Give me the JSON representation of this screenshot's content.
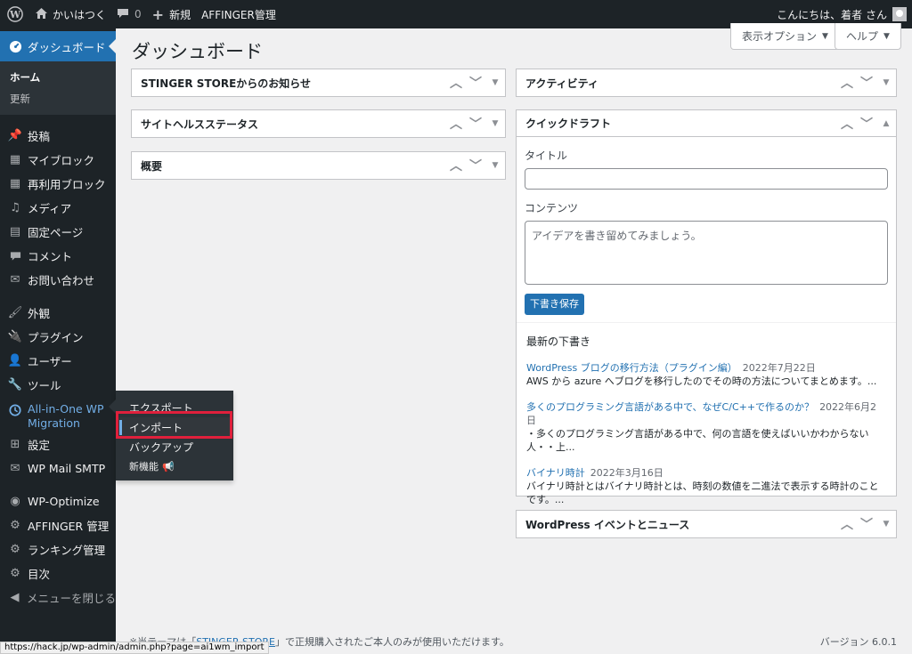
{
  "adminbar": {
    "site_name": "かいはつく",
    "comments_count": "0",
    "new_label": "新規",
    "affinger_label": "AFFINGER管理",
    "greeting": "こんにちは、着者 さん"
  },
  "sidebar": {
    "dashboard": "ダッシュボード",
    "home": "ホーム",
    "updates": "更新",
    "posts": "投稿",
    "my_blocks": "マイブロック",
    "reusable_blocks": "再利用ブロック",
    "media": "メディア",
    "pages": "固定ページ",
    "comments": "コメント",
    "contact": "お問い合わせ",
    "appearance": "外観",
    "plugins": "プラグイン",
    "users": "ユーザー",
    "tools": "ツール",
    "aio_line1": "All-in-One WP",
    "aio_line2": "Migration",
    "settings": "設定",
    "wp_mail": "WP Mail SMTP",
    "wp_optimize": "WP-Optimize",
    "affinger": "AFFINGER 管理",
    "ranking": "ランキング管理",
    "toc": "目次",
    "collapse": "メニューを閉じる"
  },
  "flyout": {
    "export": "エクスポート",
    "import": "インポート",
    "backup": "バックアップ",
    "new_features": "新機能"
  },
  "header": {
    "screen_options": "表示オプション",
    "help": "ヘルプ",
    "title": "ダッシュボード"
  },
  "widgets": {
    "stinger": "STINGER STOREからのお知らせ",
    "site_health": "サイトヘルスステータス",
    "overview": "概要",
    "activity": "アクティビティ",
    "quick_draft": "クイックドラフト",
    "events": "WordPress イベントとニュース"
  },
  "quick_draft": {
    "title_label": "タイトル",
    "content_label": "コンテンツ",
    "content_placeholder": "アイデアを書き留めてみましょう。",
    "save_button": "下書き保存",
    "recent_title": "最新の下書き",
    "drafts": [
      {
        "title": "WordPress ブログの移行方法（プラグイン編）",
        "date": "2022年7月22日",
        "excerpt": "AWS から azure へブログを移行したのでその時の方法についてまとめます。..."
      },
      {
        "title": "多くのプログラミング言語がある中で、なぜC/C++で作るのか？",
        "date": "2022年6月2日",
        "excerpt": "・多くのプログラミング言語がある中で、何の言語を使えばいいかわからない人・・上..."
      },
      {
        "title": "バイナリ時計",
        "date": "2022年3月16日",
        "excerpt": "バイナリ時計とはバイナリ時計とは、時刻の数値を二進法で表示する時計のことです。..."
      }
    ]
  },
  "footer": {
    "text_pre": "※当テーマは「",
    "link": "STINGER STORE",
    "text_post": "」で正規購入されたご本人のみが使用いただけます。",
    "version": "バージョン 6.0.1"
  },
  "statusbar": {
    "url": "https://hack.jp/wp-admin/admin.php?page=ai1wm_import"
  }
}
